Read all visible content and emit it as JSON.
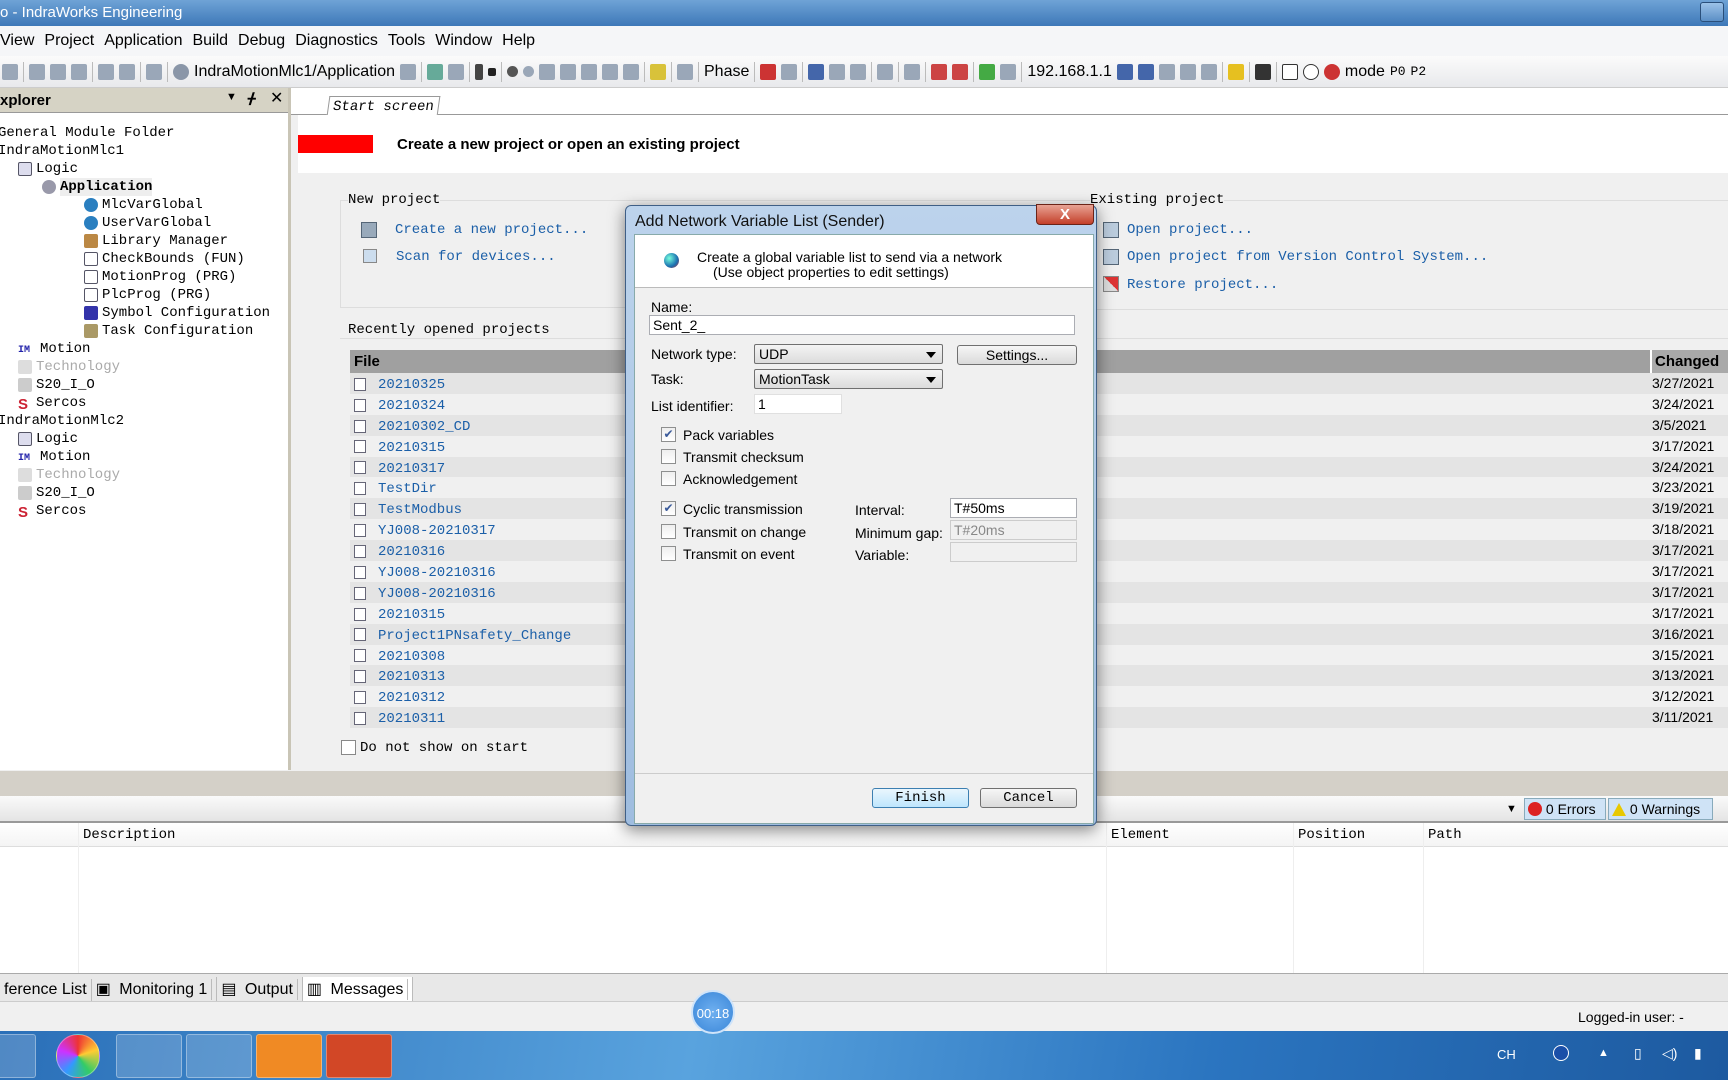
{
  "window": {
    "title": "o - IndraWorks Engineering"
  },
  "menu": [
    "View",
    "Project",
    "Application",
    "Build",
    "Debug",
    "Diagnostics",
    "Tools",
    "Window",
    "Help"
  ],
  "toolbar": {
    "active_app": "IndraMotionMlc1/Application",
    "phase": "Phase",
    "ip": "192.168.1.1",
    "mode": "mode",
    "p0": "P0",
    "p2": "P2"
  },
  "explorer": {
    "title": "xplorer",
    "items": [
      {
        "label": "General Module Folder",
        "level": 0,
        "icon": "folder-icon"
      },
      {
        "label": "IndraMotionMlc1",
        "level": 0,
        "icon": "device-icon"
      },
      {
        "label": "Logic",
        "level": 1,
        "icon": "logic-icon"
      },
      {
        "label": "Application",
        "level": 2,
        "icon": "gear-icon",
        "bold": true
      },
      {
        "label": "MlcVarGlobal",
        "level": 3,
        "icon": "globe-icon"
      },
      {
        "label": "UserVarGlobal",
        "level": 3,
        "icon": "globe-icon"
      },
      {
        "label": "Library Manager",
        "level": 3,
        "icon": "library-icon"
      },
      {
        "label": "CheckBounds (FUN)",
        "level": 3,
        "icon": "document-icon"
      },
      {
        "label": "MotionProg (PRG)",
        "level": 3,
        "icon": "document-icon"
      },
      {
        "label": "PlcProg (PRG)",
        "level": 3,
        "icon": "document-icon"
      },
      {
        "label": "Symbol Configuration",
        "level": 3,
        "icon": "symbol-icon"
      },
      {
        "label": "Task Configuration",
        "level": 3,
        "icon": "task-icon"
      },
      {
        "label": "Motion",
        "level": 1,
        "icon": "motion-icon"
      },
      {
        "label": "Technology",
        "level": 1,
        "icon": "technology-icon",
        "disabled": true
      },
      {
        "label": "S20_I_O",
        "level": 1,
        "icon": "io-icon"
      },
      {
        "label": "Sercos",
        "level": 1,
        "icon": "sercos-icon"
      },
      {
        "label": "IndraMotionMlc2",
        "level": 0,
        "icon": "device-icon"
      },
      {
        "label": "Logic",
        "level": 1,
        "icon": "logic-icon"
      },
      {
        "label": "Motion",
        "level": 1,
        "icon": "motion-icon"
      },
      {
        "label": "Technology",
        "level": 1,
        "icon": "technology-icon",
        "disabled": true
      },
      {
        "label": "S20_I_O",
        "level": 1,
        "icon": "io-icon"
      },
      {
        "label": "Sercos",
        "level": 1,
        "icon": "sercos-icon"
      }
    ]
  },
  "start": {
    "tab": "Start screen",
    "headline": "Create a new project or open an existing project",
    "accent": "#ff0000",
    "new_project": {
      "title": "New project",
      "links": [
        "Create a new project...",
        "Scan for devices..."
      ]
    },
    "existing_project": {
      "title": "Existing project",
      "links": [
        "Open project...",
        "Open project from Version Control System...",
        "Restore project..."
      ]
    },
    "recent": {
      "title": "Recently opened projects",
      "col_file": "File",
      "col_changed": "Changed",
      "rows": [
        {
          "file": "20210325",
          "changed": "3/27/2021"
        },
        {
          "file": "20210324",
          "changed": "3/24/2021"
        },
        {
          "file": "20210302_CD",
          "changed": "3/5/2021"
        },
        {
          "file": "20210315",
          "changed": "3/17/2021"
        },
        {
          "file": "20210317",
          "changed": "3/24/2021"
        },
        {
          "file": "TestDir",
          "changed": "3/23/2021"
        },
        {
          "file": "TestModbus",
          "changed": "3/19/2021"
        },
        {
          "file": "YJ008-20210317",
          "changed": "3/18/2021"
        },
        {
          "file": "20210316",
          "changed": "3/17/2021"
        },
        {
          "file": "YJ008-20210316",
          "changed": "3/17/2021"
        },
        {
          "file": "YJ008-20210316",
          "changed": "3/17/2021"
        },
        {
          "file": "20210315",
          "changed": "3/17/2021"
        },
        {
          "file": "Project1PNsafety_Change",
          "changed": "3/16/2021"
        },
        {
          "file": "20210308",
          "changed": "3/15/2021"
        },
        {
          "file": "20210313",
          "changed": "3/13/2021"
        },
        {
          "file": "20210312",
          "changed": "3/12/2021"
        },
        {
          "file": "20210311",
          "changed": "3/11/2021"
        }
      ]
    },
    "dont_show": "Do not show on start"
  },
  "messages": {
    "errors": "0 Errors",
    "warnings": "0 Warnings",
    "columns": [
      "Description",
      "Element",
      "Position",
      "Path"
    ]
  },
  "bottom_tabs": [
    "ference List",
    "Monitoring 1",
    "Output",
    "Messages"
  ],
  "status": {
    "logged_in": "Logged-in user: -"
  },
  "timer": "00:18",
  "taskbar": {
    "tray_lang": "CH"
  },
  "dialog": {
    "title": "Add Network Variable List (Sender)",
    "close": "X",
    "desc1": "Create a global variable list to send via a network",
    "desc2": "(Use object properties to edit settings)",
    "name_label": "Name:",
    "name_value": "Sent_2_",
    "network_label": "Network type:",
    "network_value": "UDP",
    "settings": "Settings...",
    "task_label": "Task:",
    "task_value": "MotionTask",
    "listid_label": "List identifier:",
    "listid_value": "1",
    "pack": {
      "label": "Pack variables",
      "checked": true
    },
    "checksum": {
      "label": "Transmit checksum",
      "checked": false
    },
    "ack": {
      "label": "Acknowledgement",
      "checked": false
    },
    "cyclic": {
      "label": "Cyclic transmission",
      "checked": true
    },
    "onchange": {
      "label": "Transmit on change",
      "checked": false
    },
    "onevent": {
      "label": "Transmit on event",
      "checked": false
    },
    "interval_label": "Interval:",
    "interval_value": "T#50ms",
    "mingap_label": "Minimum gap:",
    "mingap_value": "T#20ms",
    "variable_label": "Variable:",
    "variable_value": "",
    "finish": "Finish",
    "cancel": "Cancel"
  }
}
